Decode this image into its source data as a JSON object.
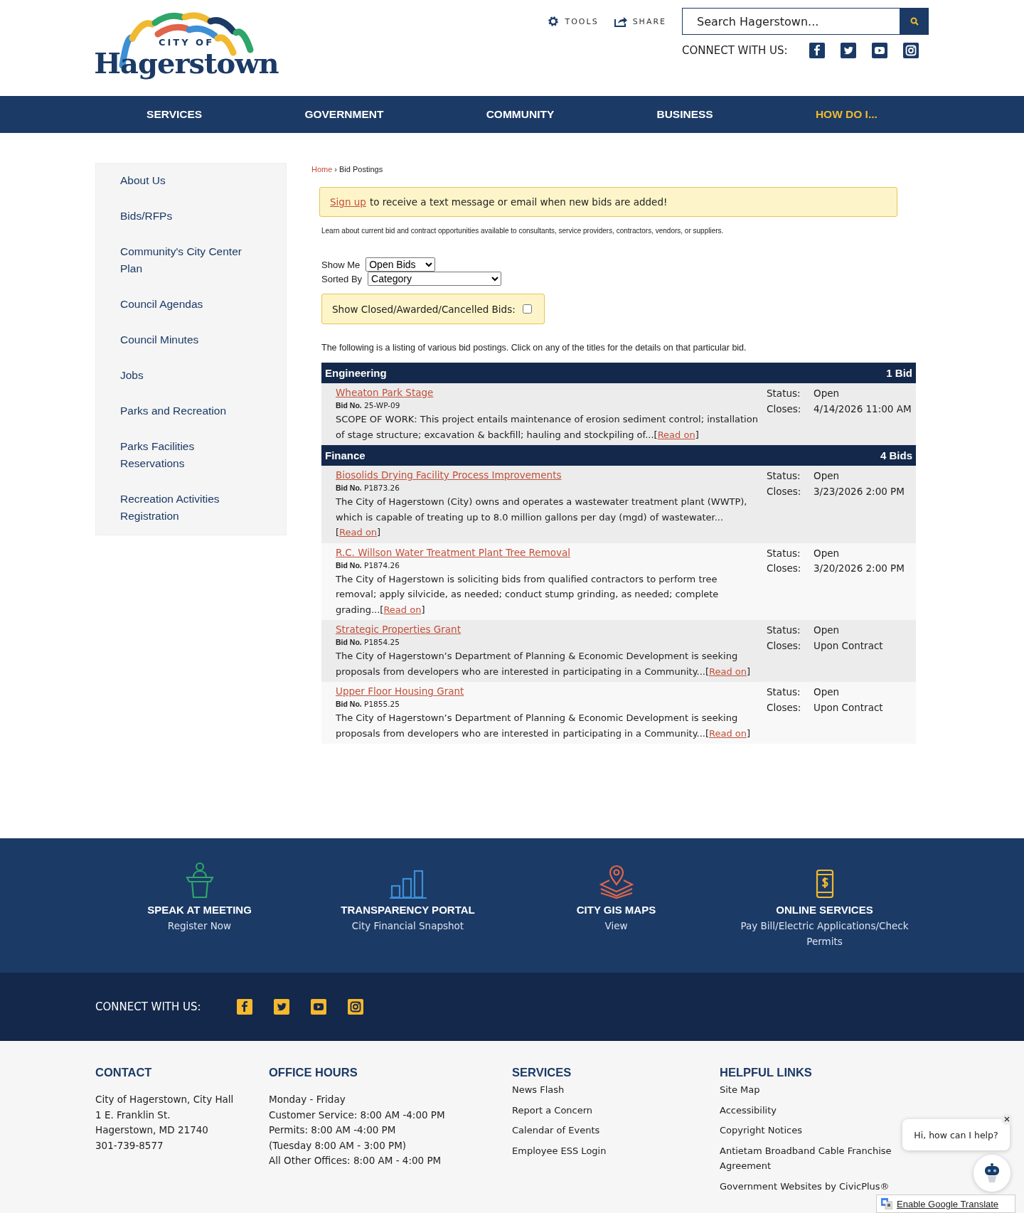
{
  "header": {
    "logo": {
      "city_of": "CITY OF",
      "name": "Hagerstown"
    },
    "tools": "TOOLS",
    "share": "SHARE",
    "search": {
      "placeholder": "Search Hagerstown..."
    },
    "connect_label": "CONNECT WITH US:"
  },
  "nav": [
    {
      "label": "SERVICES",
      "highlight": false
    },
    {
      "label": "GOVERNMENT",
      "highlight": false
    },
    {
      "label": "COMMUNITY",
      "highlight": false
    },
    {
      "label": "BUSINESS",
      "highlight": false
    },
    {
      "label": "HOW DO I...",
      "highlight": true
    }
  ],
  "sidebar": {
    "items": [
      "About Us",
      "Bids/RFPs",
      "Community's City Center Plan",
      "Council Agendas",
      "Council Minutes",
      "Jobs",
      "Parks and Recreation",
      "Parks Facilities Reservations",
      "Recreation Activities Registration"
    ]
  },
  "breadcrumb": {
    "items": [
      {
        "label": "Home",
        "link": true
      },
      {
        "label": "Bid Postings",
        "link": false
      }
    ],
    "separator": "›"
  },
  "notice": {
    "link": "Sign up",
    "text": "to receive a text message or email when new bids are added!"
  },
  "intro": "Learn about current bid and contract opportunities available to consultants, service providers, contractors, vendors, or suppliers.",
  "filters": {
    "show_me": {
      "label": "Show Me",
      "value": "Open Bids"
    },
    "sorted_by": {
      "label": "Sorted By",
      "value": "Category"
    },
    "closed_checkbox": {
      "label": "Show Closed/Awarded/Cancelled Bids:",
      "checked": false
    }
  },
  "listing_intro": "The following is a listing of various bid postings. Click on any of the titles for the details on that particular bid.",
  "categories": [
    {
      "name": "Engineering",
      "count": "1 Bid",
      "bids": [
        {
          "title": "Wheaton Park Stage",
          "bid_no_label": "Bid No.",
          "bid_no": "25-WP-09",
          "description": "SCOPE OF WORK: This project entails maintenance of erosion sediment control; installation of stage structure; excavation & backfill; hauling and stockpiling of...[",
          "read_on": "Read on",
          "after": "]",
          "status_label": "Status:",
          "status": "Open",
          "closes_label": "Closes:",
          "closes": "4/14/2026 11:00 AM"
        }
      ]
    },
    {
      "name": "Finance",
      "count": "4 Bids",
      "bids": [
        {
          "title": "Biosolids Drying Facility Process Improvements",
          "bid_no_label": "Bid No.",
          "bid_no": "P1873.26",
          "description": "The City of Hagerstown (City) owns and operates a wastewater treatment plant (WWTP), which is capable of treating up to 8.0 million gallons per day (mgd) of wastewater...[",
          "read_on": "Read on",
          "after": "]",
          "status_label": "Status:",
          "status": "Open",
          "closes_label": "Closes:",
          "closes": "3/23/2026 2:00 PM"
        },
        {
          "title": "R.C. Willson Water Treatment Plant Tree Removal",
          "bid_no_label": "Bid No.",
          "bid_no": "P1874.26",
          "description": "The City of Hagerstown is soliciting bids from qualified contractors to perform tree removal; apply silvicide, as needed; conduct stump grinding, as needed; complete grading...[",
          "read_on": "Read on",
          "after": "]",
          "status_label": "Status:",
          "status": "Open",
          "closes_label": "Closes:",
          "closes": "3/20/2026 2:00 PM"
        },
        {
          "title": "Strategic Properties Grant",
          "bid_no_label": "Bid No.",
          "bid_no": "P1854.25",
          "description": "The City of Hagerstown’s Department of Planning & Economic Development is seeking proposals from developers who are interested in participating in a Community...[",
          "read_on": "Read on",
          "after": "]",
          "status_label": "Status:",
          "status": "Open",
          "closes_label": "Closes:",
          "closes": "Upon Contract"
        },
        {
          "title": "Upper Floor Housing Grant",
          "bid_no_label": "Bid No.",
          "bid_no": "P1855.25",
          "description": "The City of Hagerstown’s Department of Planning & Economic Development is seeking proposals from developers who are interested in participating in a Community...[",
          "read_on": "Read on",
          "after": "]",
          "status_label": "Status:",
          "status": "Open",
          "closes_label": "Closes:",
          "closes": "Upon Contract"
        }
      ]
    }
  ],
  "quick_links": [
    {
      "kind": "podium",
      "color": "#2fa56a",
      "title": "SPEAK AT MEETING",
      "subtitle": "Register Now"
    },
    {
      "kind": "bars",
      "color": "#3d8fd6",
      "title": "TRANSPARENCY PORTAL",
      "subtitle": "City Financial Snapshot"
    },
    {
      "kind": "map",
      "color": "#e0654a",
      "title": "CITY GIS MAPS",
      "subtitle": "View"
    },
    {
      "kind": "phone",
      "color": "#f0b92f",
      "title": "ONLINE SERVICES",
      "subtitle": "Pay Bill/Electric Applications/Check Permits"
    }
  ],
  "footer_connect": {
    "label": "CONNECT WITH US:"
  },
  "footer": {
    "contact": {
      "heading": "CONTACT",
      "lines": [
        "City of Hagerstown, City Hall",
        "1 E. Franklin St.",
        "Hagerstown, MD 21740",
        "301-739-8577"
      ]
    },
    "office_hours": {
      "heading": "OFFICE HOURS",
      "lines": [
        "Monday - Friday",
        "Customer Service: 8:00 AM -4:00 PM",
        "Permits: 8:00 AM -4:00 PM",
        "(Tuesday 8:00 AM - 3:00 PM)",
        "All Other Offices: 8:00 AM - 4:00 PM"
      ]
    },
    "services": {
      "heading": "SERVICES",
      "links": [
        "News Flash",
        "Report a Concern",
        "Calendar of Events",
        "Employee ESS Login"
      ]
    },
    "helpful_links": {
      "heading": "HELPFUL LINKS",
      "links": [
        "Site Map",
        "Accessibility",
        "Copyright Notices",
        "Antietam Broadband Cable Franchise Agreement",
        "Government Websites by CivicPlus®"
      ]
    }
  },
  "chat": {
    "message": "Hi, how can I help?"
  },
  "translate": {
    "label": "Enable Google Translate"
  }
}
